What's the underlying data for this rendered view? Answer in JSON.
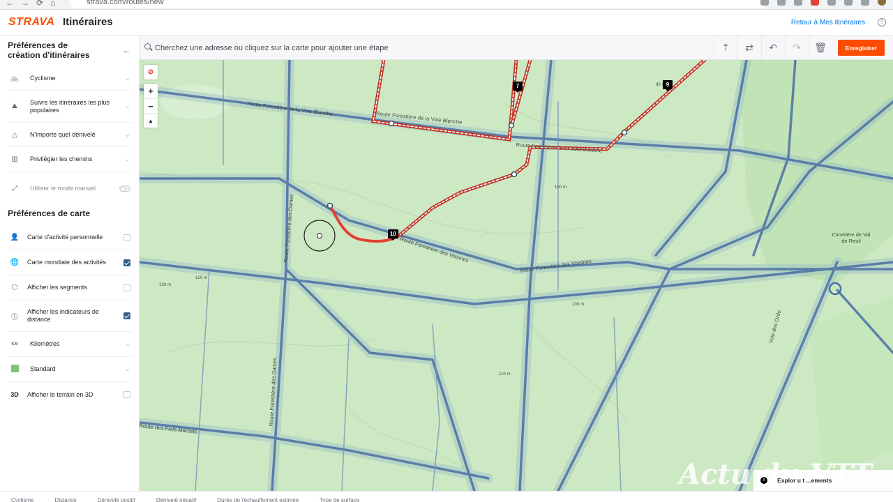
{
  "browser": {
    "url": "strava.com/routes/new",
    "nav_icons": [
      "←",
      "→",
      "⟳",
      "⌂"
    ]
  },
  "header": {
    "logo": "STRAVA",
    "title": "Itinéraires",
    "back_link": "Retour à Mes itinéraires",
    "help": "?"
  },
  "sidebar": {
    "route_prefs_title": "Préférences de création d'itinéraires",
    "route_prefs": [
      {
        "icon": "bike-icon",
        "glyph": "🚲",
        "label": "Cyclisme"
      },
      {
        "icon": "popularity-icon",
        "glyph": "⛰",
        "label": "Suivre les itinéraires les plus populaires"
      },
      {
        "icon": "elevation-icon",
        "glyph": "△",
        "label": "N'importe quel dénivelé"
      },
      {
        "icon": "surface-icon",
        "glyph": "▥",
        "label": "Privilégier les chemins"
      },
      {
        "icon": "manual-mode-icon",
        "glyph": "⤢",
        "label": "Utiliser le mode manuel"
      }
    ],
    "map_prefs_title": "Préférences de carte",
    "map_prefs": [
      {
        "icon": "person-icon",
        "glyph": "👤",
        "label": "Carte d'activité personnelle",
        "checked": false
      },
      {
        "icon": "globe-icon",
        "glyph": "🌐",
        "label": "Carte mondiale des activités",
        "checked": true
      },
      {
        "icon": "segment-icon",
        "glyph": "⬡",
        "label": "Afficher les segments",
        "checked": false
      },
      {
        "icon": "distance-marker-icon",
        "glyph": "⓵",
        "label": "Afficher les indicateurs de distance",
        "checked": true
      },
      {
        "icon": "units-icon",
        "glyph": "KM",
        "label": "Kilomètres"
      },
      {
        "icon": "map-style-icon",
        "glyph": "",
        "label": "Standard"
      },
      {
        "icon": "terrain-3d-icon",
        "glyph": "3D",
        "label": "Afficher le terrain en 3D",
        "checked": false
      }
    ]
  },
  "toolbar": {
    "search_placeholder": "Cherchez une adresse ou cliquez sur la carte pour ajouter une étape",
    "save_label": "Enregistrer"
  },
  "map": {
    "zoom_in": "+",
    "zoom_out": "−",
    "compass": "▲",
    "road_labels": [
      "Route Forestière de la Voie Blanche",
      "Route Forestière de la Voie Blanche",
      "Route Forestière de la Voie Blanche",
      "Route Forestière des Dames",
      "Route Forestière des Dames",
      "Route Forestière des Voisines",
      "Route Forestière des Voisines",
      "Route des Fiefs Marcels",
      "Voie des Ordo"
    ],
    "markers": [
      "7",
      "9",
      "10"
    ],
    "poi": "Cimetière de Val de Reuil",
    "elevation_labels": [
      "90 m",
      "100 m",
      "120 m",
      "130 m",
      "110 m",
      "100 m"
    ],
    "explore_text": "Explor   u   t   ...ements",
    "watermark": "Actu du VTT"
  },
  "bottom_tabs": [
    "Cyclisme",
    "Distance",
    "Dénivelé positif",
    "Dénivelé négatif",
    "Durée de l'échauffement estimée",
    "Type de surface"
  ],
  "colors": {
    "accent": "#fc4c02",
    "route": "#e34234",
    "heatmap": "#4a6fa5",
    "map_bg": "#cde9c4",
    "checkbox": "#315f8d"
  }
}
